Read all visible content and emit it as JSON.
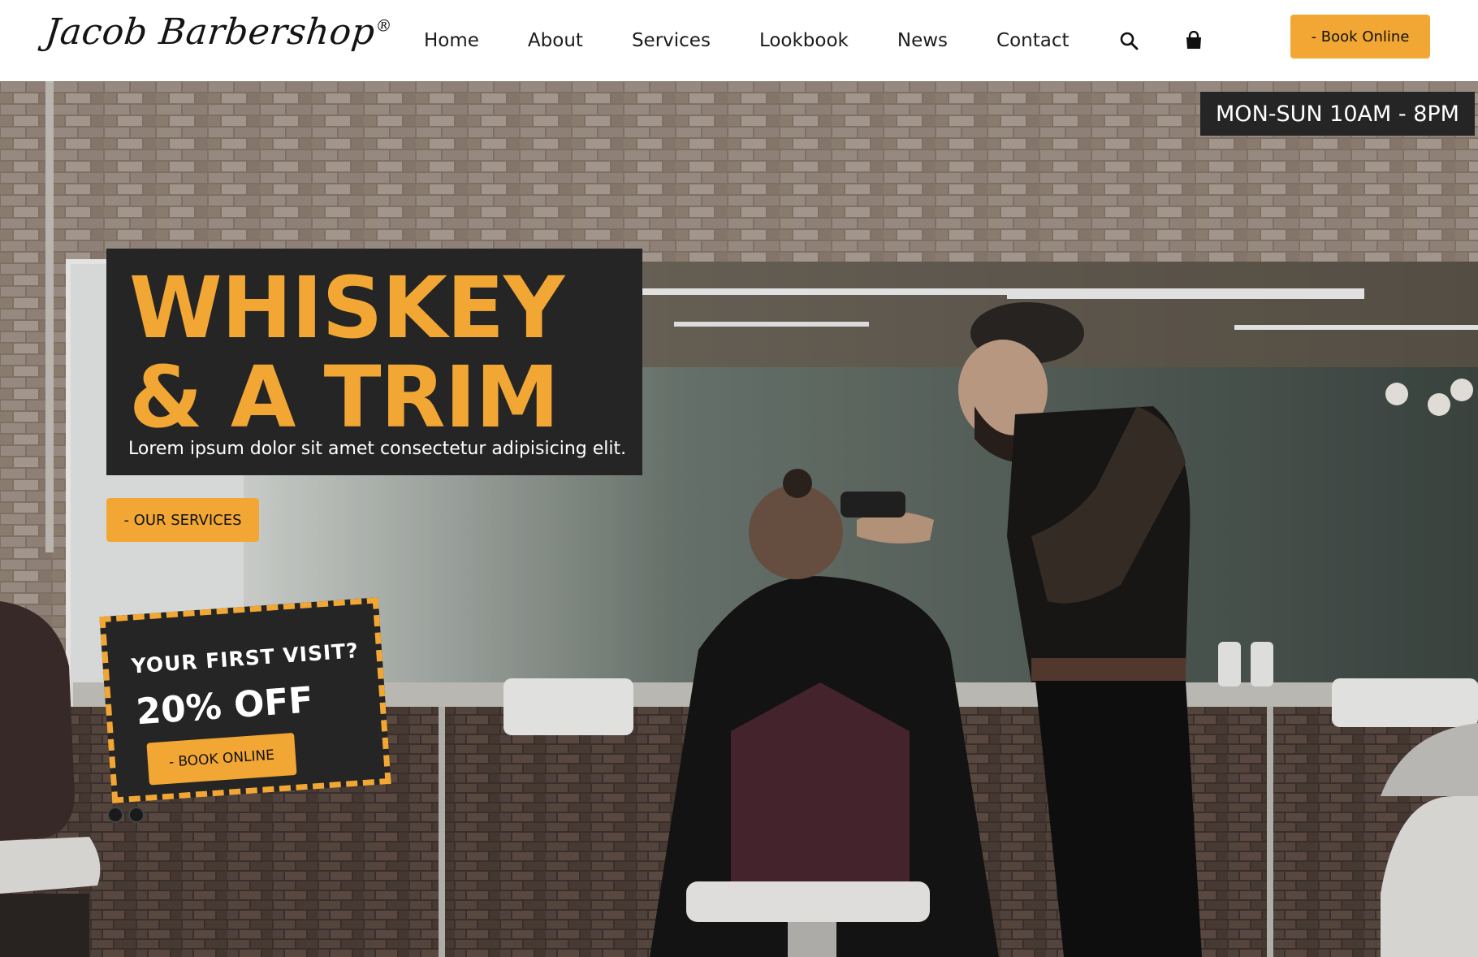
{
  "header": {
    "logo": "Jacob Barbershop",
    "logo_mark": "®",
    "nav": [
      "Home",
      "About",
      "Services",
      "Lookbook",
      "News",
      "Contact"
    ],
    "icons": [
      "search-icon",
      "shopping-bag-icon"
    ],
    "book_button": "- Book Online"
  },
  "hero": {
    "hours": "MON-SUN 10AM - 8PM",
    "headline_line1": "WHISKEY",
    "headline_line2": "& A TRIM",
    "subtext": "Lorem ipsum dolor sit amet consectetur adipisicing elit.",
    "services_button": "- OUR SERVICES",
    "coupon": {
      "title": "YOUR FIRST VISIT?",
      "offer": "20% OFF",
      "button": "- BOOK ONLINE"
    },
    "slides": 2
  },
  "colors": {
    "accent": "#f2a734",
    "dark": "#252525"
  }
}
